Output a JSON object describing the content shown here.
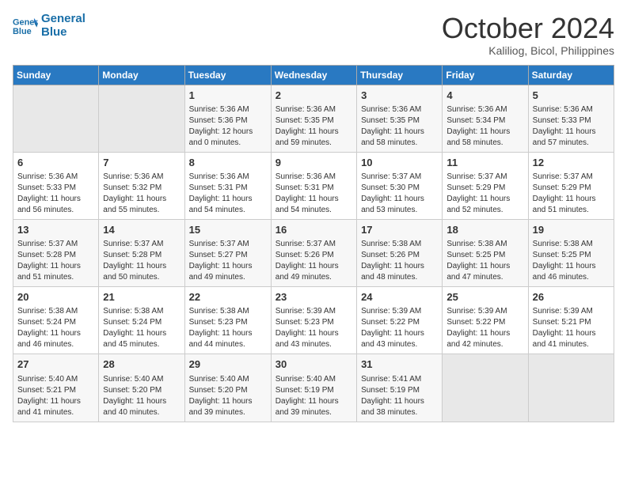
{
  "logo": {
    "line1": "General",
    "line2": "Blue"
  },
  "title": "October 2024",
  "subtitle": "Kaliliog, Bicol, Philippines",
  "headers": [
    "Sunday",
    "Monday",
    "Tuesday",
    "Wednesday",
    "Thursday",
    "Friday",
    "Saturday"
  ],
  "weeks": [
    [
      {
        "day": "",
        "info": ""
      },
      {
        "day": "",
        "info": ""
      },
      {
        "day": "1",
        "info": "Sunrise: 5:36 AM\nSunset: 5:36 PM\nDaylight: 12 hours\nand 0 minutes."
      },
      {
        "day": "2",
        "info": "Sunrise: 5:36 AM\nSunset: 5:35 PM\nDaylight: 11 hours\nand 59 minutes."
      },
      {
        "day": "3",
        "info": "Sunrise: 5:36 AM\nSunset: 5:35 PM\nDaylight: 11 hours\nand 58 minutes."
      },
      {
        "day": "4",
        "info": "Sunrise: 5:36 AM\nSunset: 5:34 PM\nDaylight: 11 hours\nand 58 minutes."
      },
      {
        "day": "5",
        "info": "Sunrise: 5:36 AM\nSunset: 5:33 PM\nDaylight: 11 hours\nand 57 minutes."
      }
    ],
    [
      {
        "day": "6",
        "info": "Sunrise: 5:36 AM\nSunset: 5:33 PM\nDaylight: 11 hours\nand 56 minutes."
      },
      {
        "day": "7",
        "info": "Sunrise: 5:36 AM\nSunset: 5:32 PM\nDaylight: 11 hours\nand 55 minutes."
      },
      {
        "day": "8",
        "info": "Sunrise: 5:36 AM\nSunset: 5:31 PM\nDaylight: 11 hours\nand 54 minutes."
      },
      {
        "day": "9",
        "info": "Sunrise: 5:36 AM\nSunset: 5:31 PM\nDaylight: 11 hours\nand 54 minutes."
      },
      {
        "day": "10",
        "info": "Sunrise: 5:37 AM\nSunset: 5:30 PM\nDaylight: 11 hours\nand 53 minutes."
      },
      {
        "day": "11",
        "info": "Sunrise: 5:37 AM\nSunset: 5:29 PM\nDaylight: 11 hours\nand 52 minutes."
      },
      {
        "day": "12",
        "info": "Sunrise: 5:37 AM\nSunset: 5:29 PM\nDaylight: 11 hours\nand 51 minutes."
      }
    ],
    [
      {
        "day": "13",
        "info": "Sunrise: 5:37 AM\nSunset: 5:28 PM\nDaylight: 11 hours\nand 51 minutes."
      },
      {
        "day": "14",
        "info": "Sunrise: 5:37 AM\nSunset: 5:28 PM\nDaylight: 11 hours\nand 50 minutes."
      },
      {
        "day": "15",
        "info": "Sunrise: 5:37 AM\nSunset: 5:27 PM\nDaylight: 11 hours\nand 49 minutes."
      },
      {
        "day": "16",
        "info": "Sunrise: 5:37 AM\nSunset: 5:26 PM\nDaylight: 11 hours\nand 49 minutes."
      },
      {
        "day": "17",
        "info": "Sunrise: 5:38 AM\nSunset: 5:26 PM\nDaylight: 11 hours\nand 48 minutes."
      },
      {
        "day": "18",
        "info": "Sunrise: 5:38 AM\nSunset: 5:25 PM\nDaylight: 11 hours\nand 47 minutes."
      },
      {
        "day": "19",
        "info": "Sunrise: 5:38 AM\nSunset: 5:25 PM\nDaylight: 11 hours\nand 46 minutes."
      }
    ],
    [
      {
        "day": "20",
        "info": "Sunrise: 5:38 AM\nSunset: 5:24 PM\nDaylight: 11 hours\nand 46 minutes."
      },
      {
        "day": "21",
        "info": "Sunrise: 5:38 AM\nSunset: 5:24 PM\nDaylight: 11 hours\nand 45 minutes."
      },
      {
        "day": "22",
        "info": "Sunrise: 5:38 AM\nSunset: 5:23 PM\nDaylight: 11 hours\nand 44 minutes."
      },
      {
        "day": "23",
        "info": "Sunrise: 5:39 AM\nSunset: 5:23 PM\nDaylight: 11 hours\nand 43 minutes."
      },
      {
        "day": "24",
        "info": "Sunrise: 5:39 AM\nSunset: 5:22 PM\nDaylight: 11 hours\nand 43 minutes."
      },
      {
        "day": "25",
        "info": "Sunrise: 5:39 AM\nSunset: 5:22 PM\nDaylight: 11 hours\nand 42 minutes."
      },
      {
        "day": "26",
        "info": "Sunrise: 5:39 AM\nSunset: 5:21 PM\nDaylight: 11 hours\nand 41 minutes."
      }
    ],
    [
      {
        "day": "27",
        "info": "Sunrise: 5:40 AM\nSunset: 5:21 PM\nDaylight: 11 hours\nand 41 minutes."
      },
      {
        "day": "28",
        "info": "Sunrise: 5:40 AM\nSunset: 5:20 PM\nDaylight: 11 hours\nand 40 minutes."
      },
      {
        "day": "29",
        "info": "Sunrise: 5:40 AM\nSunset: 5:20 PM\nDaylight: 11 hours\nand 39 minutes."
      },
      {
        "day": "30",
        "info": "Sunrise: 5:40 AM\nSunset: 5:19 PM\nDaylight: 11 hours\nand 39 minutes."
      },
      {
        "day": "31",
        "info": "Sunrise: 5:41 AM\nSunset: 5:19 PM\nDaylight: 11 hours\nand 38 minutes."
      },
      {
        "day": "",
        "info": ""
      },
      {
        "day": "",
        "info": ""
      }
    ]
  ]
}
